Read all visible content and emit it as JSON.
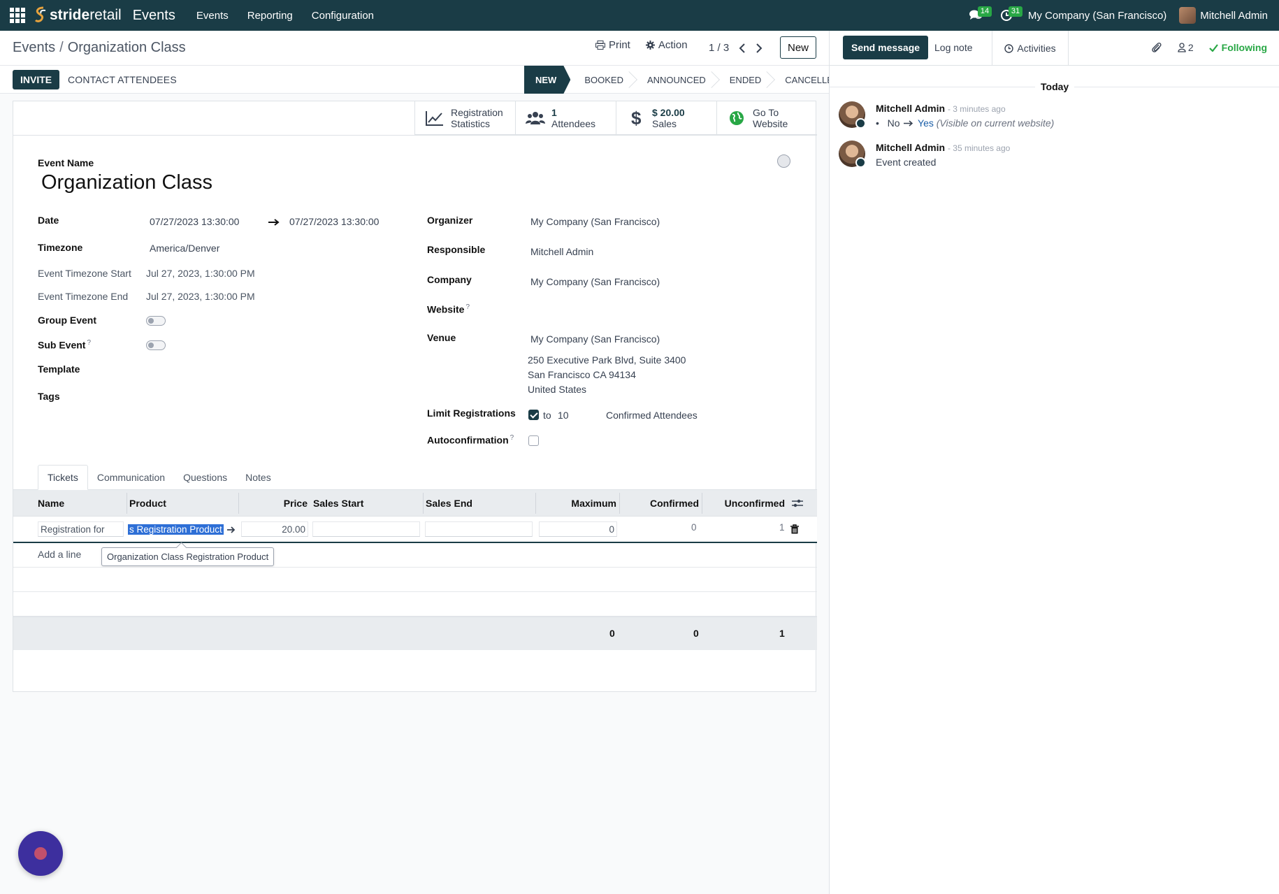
{
  "navbar": {
    "brand_prefix": "stride",
    "brand_suffix": "retail",
    "app_name": "Events",
    "menu": [
      "Events",
      "Reporting",
      "Configuration"
    ],
    "messages_badge": "14",
    "activities_badge": "31",
    "company": "My Company (San Francisco)",
    "user": "Mitchell Admin"
  },
  "control_panel": {
    "breadcrumb_parent": "Events",
    "breadcrumb_current": "Organization Class",
    "print_label": "Print",
    "action_label": "Action",
    "pager": "1 / 3",
    "new_label": "New",
    "invite_label": "INVITE",
    "contact_label": "CONTACT ATTENDEES",
    "stages": [
      "NEW",
      "BOOKED",
      "ANNOUNCED",
      "ENDED",
      "CANCELLED"
    ],
    "active_stage": "NEW"
  },
  "smart_buttons": {
    "registration_line1": "Registration",
    "registration_line2": "Statistics",
    "attendees_value": "1",
    "attendees_label": "Attendees",
    "sales_value": "$ 20.00",
    "sales_label": "Sales",
    "website_line1": "Go To",
    "website_line2": "Website"
  },
  "form": {
    "event_name_label": "Event Name",
    "event_name": "Organization Class",
    "date_label": "Date",
    "date_start": "07/27/2023 13:30:00",
    "date_end": "07/27/2023 13:30:00",
    "timezone_label": "Timezone",
    "timezone": "America/Denver",
    "tz_start_label": "Event Timezone Start",
    "tz_start": "Jul 27, 2023, 1:30:00 PM",
    "tz_end_label": "Event Timezone End",
    "tz_end": "Jul 27, 2023, 1:30:00 PM",
    "group_event_label": "Group Event",
    "sub_event_label": "Sub Event",
    "template_label": "Template",
    "tags_label": "Tags",
    "organizer_label": "Organizer",
    "organizer": "My Company (San Francisco)",
    "responsible_label": "Responsible",
    "responsible": "Mitchell Admin",
    "company_label": "Company",
    "company": "My Company (San Francisco)",
    "website_label": "Website",
    "venue_label": "Venue",
    "venue": "My Company (San Francisco)",
    "venue_address_1": "250 Executive Park Blvd, Suite 3400",
    "venue_address_2": "San Francisco CA 94134",
    "venue_address_3": "United States",
    "limit_label": "Limit Registrations",
    "limit_to": "to",
    "limit_value": "10",
    "limit_suffix": "Confirmed Attendees",
    "autoconfirm_label": "Autoconfirmation",
    "question_mark": "?"
  },
  "tabs": [
    "Tickets",
    "Communication",
    "Questions",
    "Notes"
  ],
  "tickets": {
    "columns": [
      "Name",
      "Product",
      "Price",
      "Sales Start",
      "Sales End",
      "Maximum",
      "Confirmed",
      "Unconfirmed"
    ],
    "row": {
      "name": "Registration for",
      "product": "s Registration Product",
      "price": "20.00",
      "sales_start": "",
      "sales_end": "",
      "maximum": "0",
      "confirmed": "0",
      "unconfirmed": "1"
    },
    "add_line": "Add a line",
    "tooltip": "Organization Class Registration Product",
    "totals": {
      "maximum": "0",
      "confirmed": "0",
      "unconfirmed": "1"
    }
  },
  "chatter": {
    "send_message": "Send message",
    "log_note": "Log note",
    "activities": "Activities",
    "followers_count": "2",
    "following": "Following",
    "today": "Today",
    "messages": [
      {
        "author": "Mitchell Admin",
        "time": "- 3 minutes ago",
        "old_value": "No",
        "new_value": "Yes",
        "field": "(Visible on current website)"
      },
      {
        "author": "Mitchell Admin",
        "time": "- 35 minutes ago",
        "body": "Event created"
      }
    ]
  },
  "colors": {
    "primary": "#1a3c46",
    "success": "#28a745",
    "selection": "#2e6fd6"
  }
}
